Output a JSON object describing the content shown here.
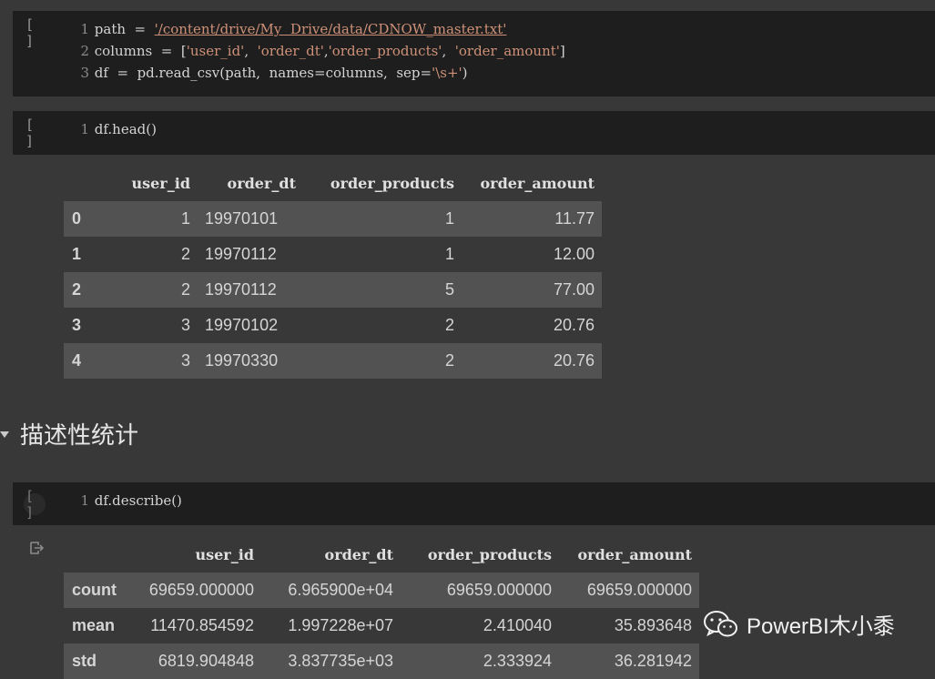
{
  "cell1": {
    "run_label": "[ ]",
    "lines": [
      {
        "num": "1",
        "parts": [
          [
            "plain",
            "path  =  "
          ],
          [
            "url",
            "'/content/drive/My  Drive/data/CDNOW_master.txt'"
          ]
        ]
      },
      {
        "num": "2",
        "parts": [
          [
            "plain",
            "columns  =  ["
          ],
          [
            "str",
            "'user_id'"
          ],
          [
            "plain",
            ",  "
          ],
          [
            "str",
            "'order_dt'"
          ],
          [
            "plain",
            ","
          ],
          [
            "str",
            "'order_products'"
          ],
          [
            "plain",
            ",  "
          ],
          [
            "str",
            "'order_amount'"
          ],
          [
            "plain",
            "]"
          ]
        ]
      },
      {
        "num": "3",
        "parts": [
          [
            "plain",
            "df  =  pd.read_csv(path,  names=columns,  sep="
          ],
          [
            "str",
            "'\\s+'"
          ],
          [
            "plain",
            ")"
          ]
        ]
      }
    ]
  },
  "cell2": {
    "run_label": "[ ]",
    "line_num": "1",
    "code": "df.head()",
    "table": {
      "columns": [
        "",
        "user_id",
        "order_dt",
        "order_products",
        "order_amount"
      ],
      "rows": [
        [
          "0",
          "1",
          "19970101",
          "1",
          "11.77"
        ],
        [
          "1",
          "2",
          "19970112",
          "1",
          "12.00"
        ],
        [
          "2",
          "2",
          "19970112",
          "5",
          "77.00"
        ],
        [
          "3",
          "3",
          "19970102",
          "2",
          "20.76"
        ],
        [
          "4",
          "3",
          "19970330",
          "2",
          "20.76"
        ]
      ]
    }
  },
  "section": {
    "title": "描述性统计"
  },
  "cell3": {
    "run_label": "[ ]",
    "line_num": "1",
    "code": "df.describe()",
    "table": {
      "columns": [
        "",
        "user_id",
        "order_dt",
        "order_products",
        "order_amount"
      ],
      "rows": [
        [
          "count",
          "69659.000000",
          "6.965900e+04",
          "69659.000000",
          "69659.000000"
        ],
        [
          "mean",
          "11470.854592",
          "1.997228e+07",
          "2.410040",
          "35.893648"
        ],
        [
          "std",
          "6819.904848",
          "3.837735e+03",
          "2.333924",
          "36.281942"
        ]
      ]
    }
  },
  "watermark": {
    "text": "PowerBI木小黍"
  },
  "icons": {
    "output": "output-icon",
    "wechat": "wechat-icon",
    "collapse": "caret-down-icon"
  }
}
